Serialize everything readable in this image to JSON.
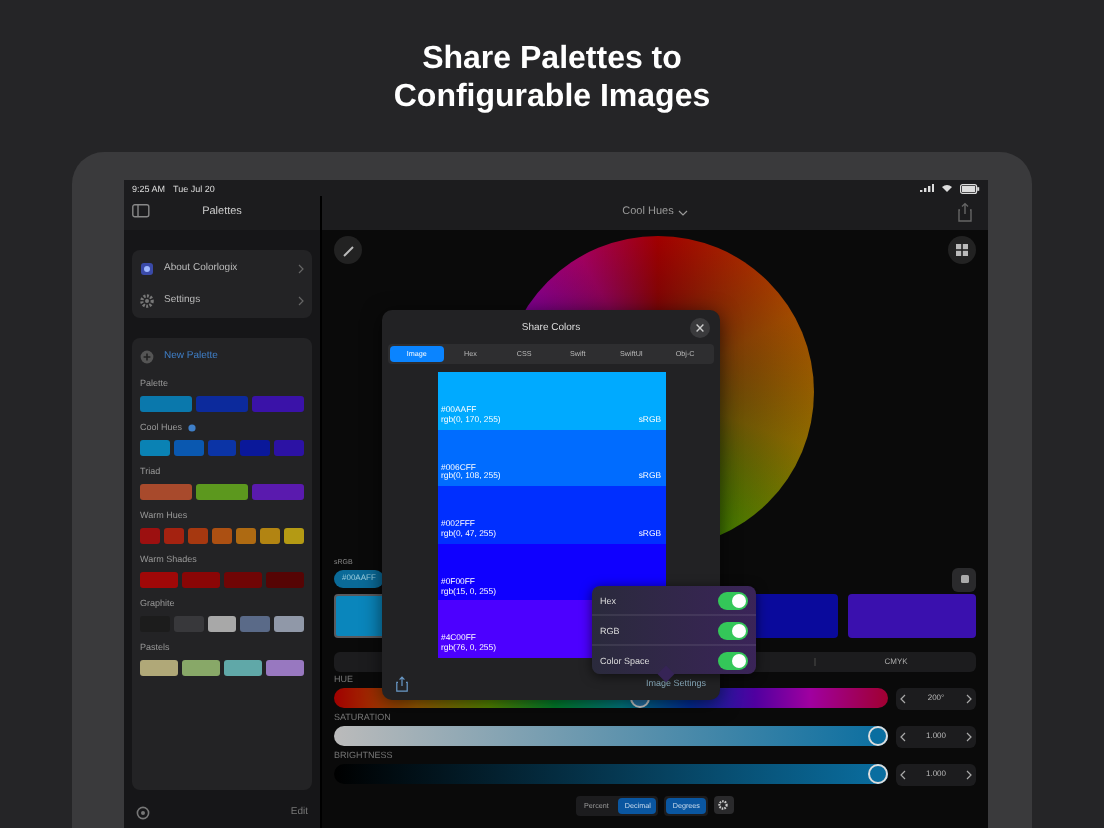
{
  "headline_lines": [
    "Share Palettes to",
    "Configurable Images"
  ],
  "status_bar": {
    "time": "9:25 AM",
    "date": "Tue Jul 20"
  },
  "sidebar": {
    "title": "Palettes",
    "menu": [
      {
        "label": "About Colorlogix",
        "kind": "app"
      },
      {
        "label": "Settings",
        "kind": "settings"
      }
    ],
    "new_palette": "New Palette",
    "palettes": [
      {
        "name": "Palette",
        "badge": false,
        "colors": [
          {
            "color": "#0a78ac"
          },
          {
            "color": "#0c2a9c"
          },
          {
            "color": "#3a12a8"
          }
        ]
      },
      {
        "name": "Cool Hues",
        "badge": true,
        "colors": [
          {
            "color": "#0a82b4"
          },
          {
            "color": "#0a58b0"
          },
          {
            "color": "#0b34a6"
          },
          {
            "color": "#0a189a"
          },
          {
            "color": "#2c12a4"
          }
        ]
      },
      {
        "name": "Triad",
        "badge": false,
        "colors": [
          {
            "color": "#a84a2c"
          },
          {
            "color": "#5c981e"
          },
          {
            "color": "#5a1aae"
          }
        ]
      },
      {
        "name": "Warm Hues",
        "badge": false,
        "colors": [
          {
            "color": "#9c1010"
          },
          {
            "color": "#a42210"
          },
          {
            "color": "#a63810"
          },
          {
            "color": "#ac5012"
          },
          {
            "color": "#ae6a12"
          },
          {
            "color": "#b28412"
          },
          {
            "color": "#b49a14"
          }
        ]
      },
      {
        "name": "Warm Shades",
        "badge": false,
        "colors": [
          {
            "color": "#a00808"
          },
          {
            "color": "#8a0606"
          },
          {
            "color": "#700505"
          },
          {
            "color": "#560404"
          }
        ]
      },
      {
        "name": "Graphite",
        "badge": false,
        "colors": [
          {
            "color": "#1c1c1c"
          },
          {
            "color": "#38383b"
          },
          {
            "color": "#a8a8a8"
          },
          {
            "color": "#5a6a88"
          },
          {
            "color": "#9098a8"
          }
        ]
      },
      {
        "name": "Pastels",
        "badge": false,
        "colors": [
          {
            "color": "#b0a878"
          },
          {
            "color": "#88a868"
          },
          {
            "color": "#60a8a8"
          },
          {
            "color": "#9878c0"
          }
        ]
      }
    ],
    "edit": "Edit"
  },
  "main": {
    "title": "Cool Hues",
    "color_space": "sRGB",
    "hex": "#00AAFF",
    "swatches": [
      {
        "color": "#0a86bc",
        "selected": true
      },
      {
        "color": "#0a0a9c",
        "selected": false
      },
      {
        "color": "#3a10ae",
        "selected": false
      }
    ],
    "model_tab": "CMYK",
    "sliders": [
      {
        "kind": "hue",
        "label": "HUE",
        "level": 0.556,
        "value": "200°"
      },
      {
        "kind": "saturation",
        "label": "SATURATION",
        "level": 1,
        "value": "1.000"
      },
      {
        "kind": "brightness",
        "label": "BRIGHTNESS",
        "level": 1,
        "value": "1.000"
      }
    ],
    "formats": [
      {
        "label": "Percent",
        "selected": false
      },
      {
        "label": "Decimal",
        "selected": true
      },
      {
        "label": "Degrees",
        "selected": true
      }
    ]
  },
  "share_modal": {
    "title": "Share Colors",
    "tabs": [
      {
        "label": "Image",
        "selected": true
      },
      {
        "label": "Hex",
        "selected": false
      },
      {
        "label": "CSS",
        "selected": false
      },
      {
        "label": "Swift",
        "selected": false
      },
      {
        "label": "SwiftUI",
        "selected": false
      },
      {
        "label": "Obj-C",
        "selected": false
      }
    ],
    "strips": [
      {
        "color": "#00aaff",
        "hex": "#00AAFF",
        "rgb": "rgb(0, 170, 255)",
        "space": "sRGB"
      },
      {
        "color": "#006cff",
        "hex": "#006CFF",
        "rgb": "rgb(0, 108, 255)",
        "space": "sRGB"
      },
      {
        "color": "#002fff",
        "hex": "#002FFF",
        "rgb": "rgb(0, 47, 255)",
        "space": "sRGB"
      },
      {
        "color": "#0f00ff",
        "hex": "#0F00FF",
        "rgb": "rgb(15, 0, 255)"
      },
      {
        "color": "#4c00ff",
        "hex": "#4C00FF",
        "rgb": "rgb(76, 0, 255)"
      }
    ],
    "settings_button": "Image Settings"
  },
  "image_settings": {
    "options": [
      {
        "label": "Hex",
        "on": true
      },
      {
        "label": "RGB",
        "on": true
      },
      {
        "label": "Color Space",
        "on": true
      }
    ]
  }
}
